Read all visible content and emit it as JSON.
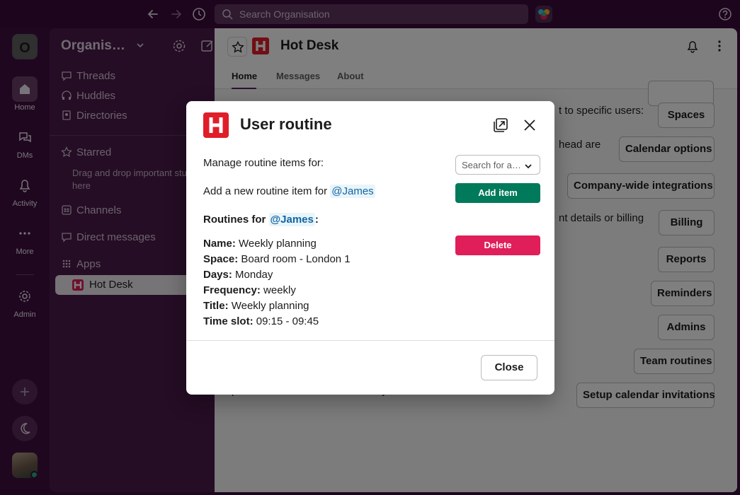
{
  "topbar": {
    "search_placeholder": "Search Organisation"
  },
  "rail": {
    "workspace_initial": "O",
    "items": [
      {
        "label": "Home"
      },
      {
        "label": "DMs"
      },
      {
        "label": "Activity"
      },
      {
        "label": "More"
      },
      {
        "label": "Admin"
      }
    ]
  },
  "sidebar": {
    "title": "Organisation",
    "sections": [
      {
        "label": "Threads"
      },
      {
        "label": "Huddles"
      },
      {
        "label": "Directories"
      },
      {
        "label": "Starred"
      },
      {
        "label": "Channels"
      },
      {
        "label": "Direct messages"
      },
      {
        "label": "Apps"
      }
    ],
    "starred_hint": "Drag and drop important stuff here",
    "active_app": "Hot Desk"
  },
  "main": {
    "title": "Hot Desk",
    "tabs": [
      {
        "label": "Home"
      },
      {
        "label": "Messages"
      },
      {
        "label": "About"
      }
    ],
    "behind_text": [
      "t to specific users:",
      "head are",
      "nt details or billing",
      "p",
      "y"
    ],
    "buttons": [
      "Spaces",
      "Calendar options",
      "Company-wide integrations",
      "Billing",
      "Reports",
      "Reminders",
      "Admins",
      "Team routines",
      "Setup calendar invitations"
    ]
  },
  "modal": {
    "title": "User routine",
    "manage_label": "Manage routine items for:",
    "select_placeholder": "Search for a user",
    "add_label": "Add a new routine item for",
    "mention": "@James",
    "add_button": "Add item",
    "routines_label": "Routines for",
    "routines_colon": ":",
    "delete_button": "Delete",
    "routine": {
      "name_label": "Name:",
      "name": "Weekly planning",
      "space_label": "Space:",
      "space": "Board room - London 1",
      "days_label": "Days:",
      "days": "Monday",
      "frequency_label": "Frequency:",
      "frequency": "weekly",
      "title_label": "Title:",
      "title": "Weekly planning",
      "time_label": "Time slot:",
      "time": "09:15 - 09:45"
    },
    "close_button": "Close"
  },
  "colors": {
    "aubergine": "#3f0e40",
    "add_green": "#007a5a",
    "delete_red": "#e01e5a",
    "mention_blue": "#1264a3"
  }
}
